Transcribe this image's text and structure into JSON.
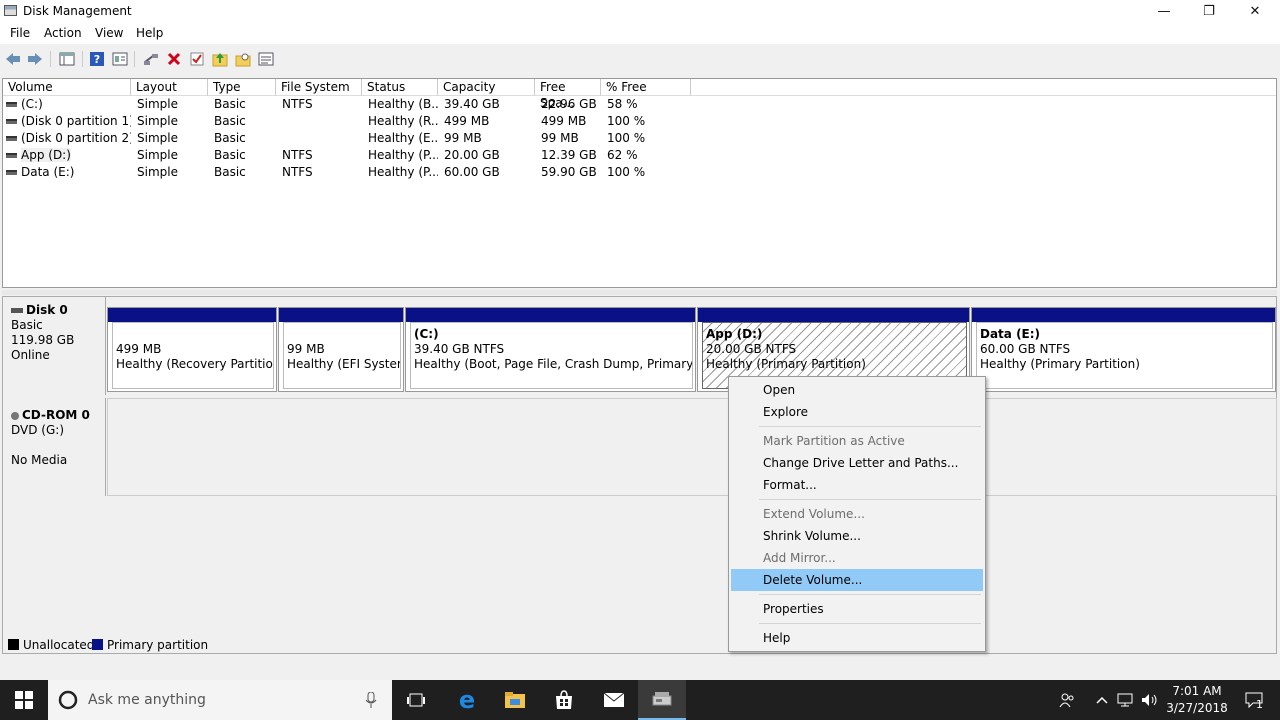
{
  "window": {
    "title": "Disk Management",
    "minimize_glyph": "—",
    "restore_glyph": "❐",
    "close_glyph": "✕"
  },
  "menu": [
    "File",
    "Action",
    "View",
    "Help"
  ],
  "toolbar": {
    "icons": [
      "back-arrow-icon",
      "forward-arrow-icon",
      "show-hide-console-tree-icon",
      "help-icon",
      "properties-icon",
      "connect-icon",
      "delete-icon",
      "check-icon",
      "up-folder-icon",
      "open-folder-icon",
      "list-view-icon"
    ],
    "delete_color": "#d0021b"
  },
  "volume_table": {
    "columns": [
      "Volume",
      "Layout",
      "Type",
      "File System",
      "Status",
      "Capacity",
      "Free Spa...",
      "% Free"
    ],
    "rows": [
      [
        "(C:)",
        "Simple",
        "Basic",
        "NTFS",
        "Healthy (B...",
        "39.40 GB",
        "22.96 GB",
        "58 %"
      ],
      [
        "(Disk 0 partition 1)",
        "Simple",
        "Basic",
        "",
        "Healthy (R...",
        "499 MB",
        "499 MB",
        "100 %"
      ],
      [
        "(Disk 0 partition 2)",
        "Simple",
        "Basic",
        "",
        "Healthy (E...",
        "99 MB",
        "99 MB",
        "100 %"
      ],
      [
        "App (D:)",
        "Simple",
        "Basic",
        "NTFS",
        "Healthy (P...",
        "20.00 GB",
        "12.39 GB",
        "62 %"
      ],
      [
        "Data (E:)",
        "Simple",
        "Basic",
        "NTFS",
        "Healthy (P...",
        "60.00 GB",
        "59.90 GB",
        "100 %"
      ]
    ]
  },
  "disks": [
    {
      "name": "Disk 0",
      "type": "Basic",
      "size": "119.98 GB",
      "status": "Online",
      "partitions": [
        {
          "name": "",
          "size": "499 MB",
          "status": "Healthy (Recovery Partition)"
        },
        {
          "name": "",
          "size": "99 MB",
          "status": "Healthy (EFI System F"
        },
        {
          "name": "(C:)",
          "size": "39.40 GB NTFS",
          "status": "Healthy (Boot, Page File, Crash Dump, Primary Partit"
        },
        {
          "name": "App  (D:)",
          "size": "20.00 GB NTFS",
          "status": "Healthy (Primary Partition)"
        },
        {
          "name": "Data  (E:)",
          "size": "60.00 GB NTFS",
          "status": "Healthy (Primary Partition)"
        }
      ]
    },
    {
      "name": "CD-ROM 0",
      "type": "DVD (G:)",
      "size": "",
      "status": "No Media"
    }
  ],
  "legend": [
    {
      "label": "Unallocated",
      "color": "#000000"
    },
    {
      "label": "Primary partition",
      "color": "#0a1186"
    }
  ],
  "context_menu": {
    "items": [
      "Open",
      "Explore",
      "Mark Partition as Active",
      "Change Drive Letter and Paths...",
      "Format...",
      "Extend Volume...",
      "Shrink Volume...",
      "Add Mirror...",
      "Delete Volume...",
      "Properties",
      "Help"
    ],
    "disabled": [
      "Mark Partition as Active",
      "Extend Volume...",
      "Add Mirror..."
    ],
    "highlighted": "Delete Volume..."
  },
  "taskbar": {
    "search_placeholder": "Ask me anything",
    "time": "7:01 AM",
    "date": "3/27/2018",
    "notification_count": "1",
    "pinned_icons": [
      "task-view-icon",
      "edge-icon",
      "file-explorer-icon",
      "store-icon",
      "mail-icon",
      "disk-management-icon"
    ],
    "tray_icons": [
      "people-icon",
      "show-hidden-icons-icon",
      "network-icon",
      "volume-icon"
    ]
  }
}
